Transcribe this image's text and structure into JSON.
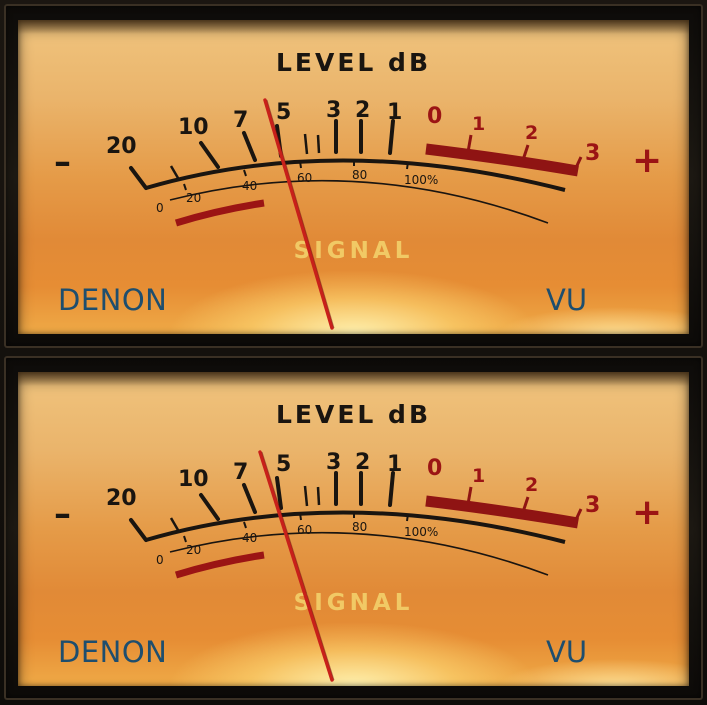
{
  "meters": [
    {
      "id": "top",
      "title": "LEVEL dB",
      "label_signal": "SIGNAL",
      "brand": "DENON",
      "unit": "VU",
      "minus_symbol": "–",
      "plus_symbol": "+",
      "db_scale": [
        "20",
        "10",
        "7",
        "5",
        "3",
        "2",
        "1",
        "0",
        "1",
        "2",
        "3"
      ],
      "percent_scale": [
        "0",
        "20",
        "40",
        "60",
        "80",
        "100%"
      ],
      "needle_db": -5.2
    },
    {
      "id": "bottom",
      "title": "LEVEL dB",
      "label_signal": "SIGNAL",
      "brand": "DENON",
      "unit": "VU",
      "minus_symbol": "–",
      "plus_symbol": "+",
      "db_scale": [
        "20",
        "10",
        "7",
        "5",
        "3",
        "2",
        "1",
        "0",
        "1",
        "2",
        "3"
      ],
      "percent_scale": [
        "0",
        "20",
        "40",
        "60",
        "80",
        "100%"
      ],
      "needle_db": -5.6
    }
  ],
  "colors": {
    "face_accent": "#e59b48",
    "ink": "#1a1510",
    "red_zone": "#9b1414",
    "needle": "#c8201a",
    "brand_blue": "#1e4e6e",
    "signal_gold": "#f3d06b"
  }
}
